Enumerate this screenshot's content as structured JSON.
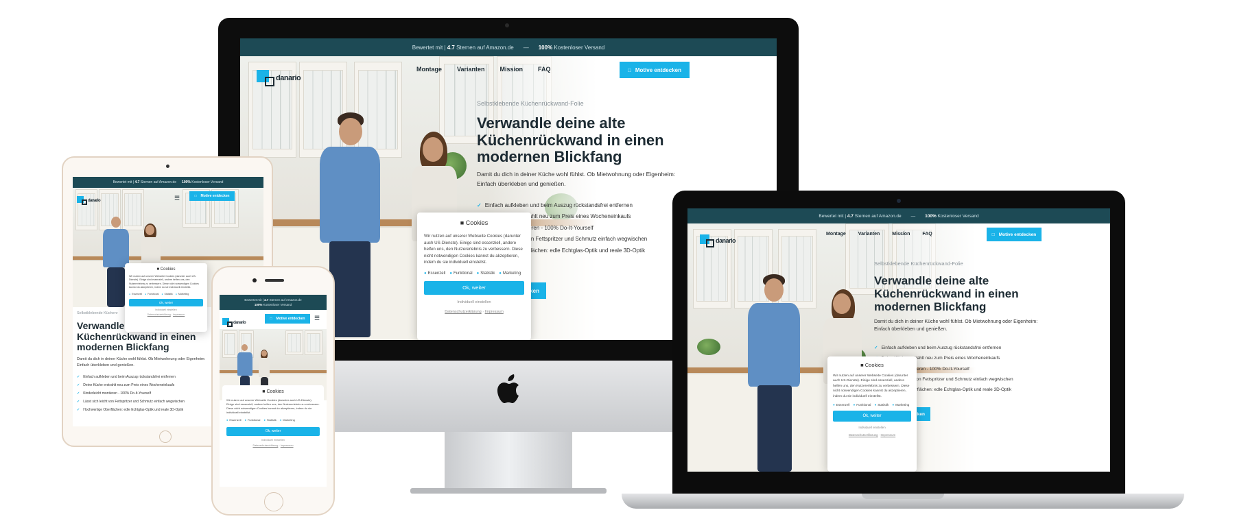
{
  "topbar": {
    "rating_prefix": "Bewertet mit",
    "rating_value": "4.7",
    "rating_suffix": "Sternen auf Amazon.de",
    "shipping_value": "100%",
    "shipping_suffix": "Kostenloser Versand",
    "separator": "—"
  },
  "logo": {
    "text": "danario"
  },
  "nav": {
    "items": [
      "Montage",
      "Varianten",
      "Mission",
      "FAQ"
    ]
  },
  "cta": {
    "label": "Motive entdecken"
  },
  "hero": {
    "subtitle": "Selbstklebende Küchenrückwand-Folie",
    "title_line1": "Verwandle deine alte",
    "title_line2": "Küchenrückwand in einen",
    "title_line3": "modernen Blickfang",
    "paragraph": "Damit du dich in deiner Küche wohl fühlst. Ob Mietwohnung oder Eigenheim: Einfach überkleben und genießen.",
    "checks": [
      "Einfach aufkleben und beim Auszug rückstandsfrei entfernen",
      "Deine Küche erstrahlt neu zum Preis eines Wocheneinkaufs",
      "Kinderleicht montieren - 100% Do-It-Yourself",
      "Lässt sich leicht von Fettspritzer und Schmutz einfach wegwischen",
      "Hochwertige Oberflächen: edle Echtglas-Optik und reale 3D-Optik"
    ],
    "hero_button_fragment": "ken"
  },
  "cookie": {
    "title": "Cookies",
    "body": "Wir nutzen auf unserer Webseite Cookies (darunter auch US-Dienste). Einige sind essenziell, andere helfen uns, den Nutzererlebnis zu verbessern. Diese nicht notwendigen Cookies kannst du akzeptieren, indem du sie individuell einstellst.",
    "categories": [
      "Essenzell",
      "Funktional",
      "Statistik",
      "Marketing"
    ],
    "accept_label": "Ok, weiter",
    "individual_label": "Individuell einstellen",
    "privacy_link": "Datenschutzerklärung",
    "imprint_link": "Impressum"
  },
  "colors": {
    "topbar": "#1d4a55",
    "accent": "#1ab3e8",
    "dark_text": "#1d2b33"
  },
  "icons": {
    "cta_icon": "document-icon",
    "menu_icon": "hamburger-menu-icon",
    "cookie_icon": "cookie-icon",
    "apple_logo": "apple-logo-icon"
  }
}
